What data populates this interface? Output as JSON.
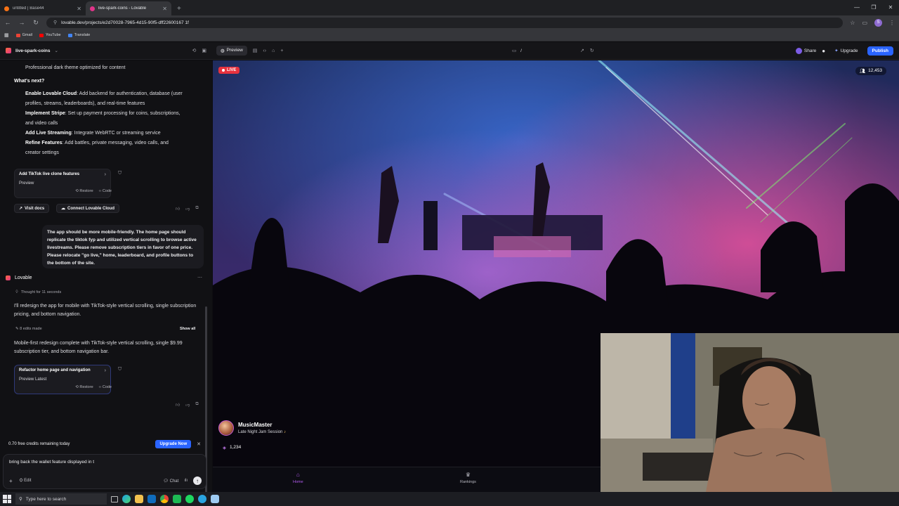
{
  "browser": {
    "tabs": [
      {
        "title": "untitled | Base44",
        "active": false,
        "color": "#f97316"
      },
      {
        "title": "live-spark-coins - Lovable",
        "active": true,
        "color": "#e0348a"
      }
    ],
    "url": "lovable.dev/projects/e2d70028-7965-4d15-90f5-dff22600167 1f",
    "bookmarks": [
      {
        "label": "Gmail",
        "color": "#ea4335"
      },
      {
        "label": "YouTube",
        "color": "#ff0000"
      },
      {
        "label": "Translate",
        "color": "#4285f4"
      }
    ],
    "profile_initial": "S"
  },
  "header": {
    "project_name": "live-spark-coins",
    "preview_label": "Preview",
    "route": "/",
    "share_label": "Share",
    "upgrade_label": "Upgrade",
    "publish_label": "Publish"
  },
  "chat": {
    "top_line": "Professional dark theme optimized for content",
    "whats_next_heading": "What's next?",
    "next_items": [
      {
        "bold": "Enable Lovable Cloud",
        "text": ": Add backend for authentication, database (user",
        "cont": "profiles, streams, leaderboards), and real-time features"
      },
      {
        "bold": "Implement Stripe",
        "text": ": Set up payment processing for coins, subscriptions,",
        "cont": "and video calls"
      },
      {
        "bold": "Add Live Streaming",
        "text": ": Integrate WebRTC or streaming service",
        "cont": ""
      },
      {
        "bold": "Refine Features",
        "text": ": Add battles, private messaging, video calls, and",
        "cont": "creator settings"
      }
    ],
    "card1": {
      "title": "Add TikTok live clone features",
      "subtitle": "Preview",
      "restore": "Restore",
      "code": "Code"
    },
    "visit_docs": "Visit docs",
    "connect_cloud": "Connect Lovable Cloud",
    "user_message": "The app should be more mobile-friendly. The home page should replicate the tiktok fyp and utilized vertical scrolling to browse active livestreams. Please remove subscription tiers in favor of one price. Please relocate \"go live,\" home, leaderboard, and profile buttons to the bottom of the site.",
    "assistant_name": "Lovable",
    "thought": "Thought for 11 seconds",
    "reply1": "I'll redesign the app for mobile with TikTok-style vertical scrolling, single subscription pricing, and bottom navigation.",
    "edits_made": "8 edits made",
    "show_all": "Show all",
    "reply2": "Mobile-first redesign complete with TikTok-style vertical scrolling, single $9.99 subscription tier, and bottom navigation bar.",
    "card2": {
      "title": "Refactor home page and navigation",
      "subtitle": "Preview Latest",
      "restore": "Restore",
      "code": "Code"
    },
    "credits": "0.70 free credits remaining today",
    "upgrade_now": "Upgrade Now",
    "input_value": "bring back the wallet feature displayed in t",
    "edit_label": "Edit",
    "chat_label": "Chat"
  },
  "preview": {
    "live_label": "LIVE",
    "viewers": "12,453",
    "streamer_name": "MusicMaster",
    "stream_title": "Late Night Jam Session",
    "coins": "1,234",
    "nav": [
      {
        "label": "Home",
        "icon": "home-icon"
      },
      {
        "label": "Rankings",
        "icon": "trophy-icon"
      }
    ]
  },
  "taskbar": {
    "search_placeholder": "Type here to search"
  },
  "colors": {
    "accent": "#2a64ff",
    "live": "#e6323e",
    "home_active": "#b45cf0"
  }
}
